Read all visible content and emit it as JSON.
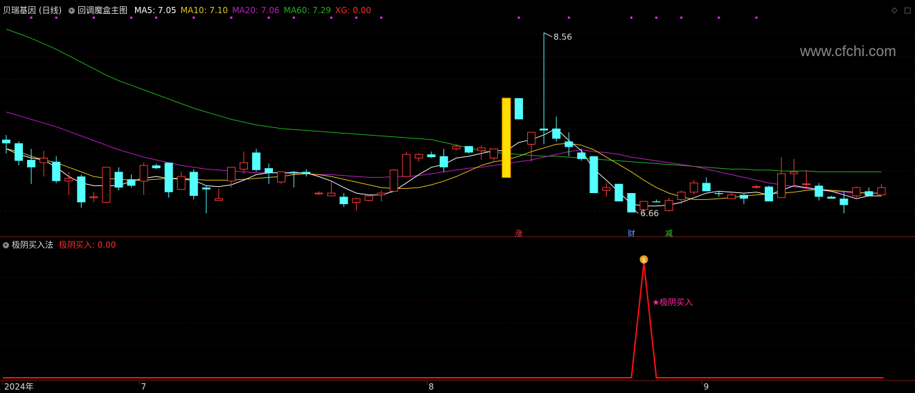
{
  "main_header": {
    "stock": "贝瑞基因 (日线)",
    "indicator_name": "回调魔盒主图",
    "items": [
      {
        "label": "MA5: 7.05",
        "color": "#ffffff"
      },
      {
        "label": "MA10: 7.10",
        "color": "#e6c619"
      },
      {
        "label": "MA20: 7.06",
        "color": "#c01ec8"
      },
      {
        "label": "MA60: 7.29",
        "color": "#1eb41e"
      },
      {
        "label": "XG: 0.00",
        "color": "#ff2a2a"
      }
    ]
  },
  "sub_header": {
    "indicator_name": "极阴买入法",
    "value_label": "极阴买入: 0.00"
  },
  "watermark": "www.cfchi.com",
  "controls": {
    "diamond": "◇",
    "box": "□"
  },
  "colors": {
    "up": "#ff3a3a",
    "down": "#54ffff",
    "ma5": "#ffffff",
    "ma10": "#e6c619",
    "ma20": "#c01ec8",
    "ma60": "#1eb41e",
    "signal": "#ff1010",
    "marker": "#ff2aff",
    "grid": "#3a0a0a",
    "axis": "#7a1a1a"
  },
  "chart_data": {
    "type": "candlestick",
    "x_labels": [
      "2024年",
      "7",
      "8",
      "9"
    ],
    "x_label_index": [
      0,
      11,
      34,
      56
    ],
    "ylim": [
      6.4,
      8.75
    ],
    "candles": [
      [
        7.4,
        7.45,
        7.25,
        7.36
      ],
      [
        7.36,
        7.38,
        7.12,
        7.17
      ],
      [
        7.18,
        7.3,
        6.92,
        7.1
      ],
      [
        7.15,
        7.28,
        7.0,
        7.2
      ],
      [
        7.16,
        7.22,
        6.93,
        6.95
      ],
      [
        6.95,
        7.05,
        6.8,
        6.98
      ],
      [
        7.0,
        7.02,
        6.66,
        6.72
      ],
      [
        6.77,
        6.83,
        6.72,
        6.78
      ],
      [
        6.72,
        7.1,
        6.72,
        7.1
      ],
      [
        7.05,
        7.1,
        6.85,
        6.88
      ],
      [
        6.97,
        7.02,
        6.88,
        6.9
      ],
      [
        6.95,
        7.15,
        6.8,
        7.12
      ],
      [
        7.12,
        7.14,
        7.08,
        7.09
      ],
      [
        7.15,
        7.15,
        6.77,
        6.83
      ],
      [
        6.86,
        7.05,
        6.86,
        7.0
      ],
      [
        7.05,
        7.08,
        6.75,
        6.79
      ],
      [
        6.88,
        6.9,
        6.6,
        6.86
      ],
      [
        6.74,
        6.87,
        6.74,
        6.76
      ],
      [
        6.95,
        7.1,
        6.88,
        7.1
      ],
      [
        7.08,
        7.27,
        7.03,
        7.15
      ],
      [
        7.26,
        7.3,
        7.05,
        7.07
      ],
      [
        7.09,
        7.14,
        6.92,
        7.04
      ],
      [
        6.94,
        7.05,
        6.92,
        7.05
      ],
      [
        7.05,
        7.06,
        6.88,
        7.04
      ],
      [
        7.05,
        7.08,
        7.0,
        7.03
      ],
      [
        6.82,
        6.84,
        6.8,
        6.82
      ],
      [
        6.79,
        6.95,
        6.79,
        6.82
      ],
      [
        6.78,
        6.82,
        6.67,
        6.7
      ],
      [
        6.72,
        6.77,
        6.63,
        6.76
      ],
      [
        6.74,
        6.8,
        6.73,
        6.79
      ],
      [
        6.8,
        6.85,
        6.73,
        6.82
      ],
      [
        6.84,
        7.08,
        6.84,
        7.07
      ],
      [
        7.0,
        7.27,
        7.0,
        7.24
      ],
      [
        7.2,
        7.25,
        7.16,
        7.24
      ],
      [
        7.24,
        7.27,
        7.2,
        7.21
      ],
      [
        7.22,
        7.3,
        7.05,
        7.1
      ],
      [
        7.3,
        7.35,
        7.28,
        7.33
      ],
      [
        7.33,
        7.3,
        7.25,
        7.26
      ],
      [
        7.28,
        7.34,
        7.18,
        7.31
      ],
      [
        7.2,
        7.3,
        7.17,
        7.3
      ],
      [
        7.61,
        7.61,
        7.18,
        7.18
      ],
      [
        7.85,
        7.85,
        7.62,
        7.62
      ],
      [
        7.35,
        7.48,
        7.16,
        7.48
      ],
      [
        7.52,
        8.56,
        7.35,
        7.5
      ],
      [
        7.52,
        7.65,
        7.38,
        7.41
      ],
      [
        7.38,
        7.48,
        7.22,
        7.32
      ],
      [
        7.26,
        7.3,
        7.17,
        7.19
      ],
      [
        7.22,
        7.22,
        6.82,
        6.82
      ],
      [
        6.85,
        6.93,
        6.78,
        6.88
      ],
      [
        6.92,
        6.92,
        6.73,
        6.73
      ],
      [
        6.82,
        6.82,
        6.66,
        6.61
      ],
      [
        6.64,
        6.73,
        6.58,
        6.73
      ],
      [
        6.73,
        6.75,
        6.72,
        6.72
      ],
      [
        6.63,
        6.77,
        6.62,
        6.74
      ],
      [
        6.75,
        6.85,
        6.7,
        6.83
      ],
      [
        6.83,
        6.96,
        6.8,
        6.93
      ],
      [
        6.93,
        6.99,
        6.89,
        6.84
      ],
      [
        6.82,
        6.84,
        6.78,
        6.81
      ],
      [
        6.76,
        6.82,
        6.76,
        6.8
      ],
      [
        6.8,
        6.81,
        6.7,
        6.76
      ],
      [
        6.89,
        6.91,
        6.87,
        6.89
      ],
      [
        6.89,
        6.9,
        6.73,
        6.73
      ],
      [
        6.77,
        7.21,
        6.77,
        7.03
      ],
      [
        7.03,
        7.19,
        6.89,
        7.05
      ],
      [
        6.92,
        7.07,
        6.88,
        6.92
      ],
      [
        6.9,
        6.93,
        6.74,
        6.78
      ],
      [
        6.78,
        6.79,
        6.76,
        6.76
      ],
      [
        6.76,
        6.83,
        6.6,
        6.69
      ],
      [
        6.79,
        6.89,
        6.77,
        6.88
      ],
      [
        6.84,
        6.88,
        6.79,
        6.79
      ],
      [
        6.8,
        6.92,
        6.8,
        6.88
      ]
    ],
    "signal_bar_index": 40,
    "ma5": [
      7.3,
      7.24,
      7.2,
      7.18,
      7.1,
      7.0,
      6.93,
      6.9,
      6.9,
      6.9,
      6.95,
      6.98,
      7.0,
      6.98,
      6.97,
      6.96,
      6.9,
      6.89,
      6.91,
      6.96,
      7.02,
      7.04,
      7.04,
      7.04,
      7.04,
      7.0,
      6.95,
      6.88,
      6.82,
      6.8,
      6.8,
      6.84,
      6.93,
      7.02,
      7.1,
      7.13,
      7.2,
      7.22,
      7.25,
      7.28,
      7.28,
      7.37,
      7.4,
      7.45,
      7.52,
      7.39,
      7.28,
      7.08,
      6.96,
      6.83,
      6.7,
      6.68,
      6.68,
      6.69,
      6.72,
      6.77,
      6.82,
      6.84,
      6.83,
      6.82,
      6.83,
      6.8,
      6.85,
      6.9,
      6.88,
      6.86,
      6.84,
      6.8,
      6.76,
      6.79,
      6.79
    ],
    "ma10": [
      7.3,
      7.27,
      7.22,
      7.18,
      7.15,
      7.1,
      7.05,
      7.0,
      6.98,
      6.97,
      6.96,
      6.96,
      6.97,
      6.98,
      6.98,
      6.97,
      6.96,
      6.96,
      6.96,
      6.97,
      6.98,
      6.99,
      7.0,
      7.02,
      7.03,
      7.02,
      7.0,
      6.97,
      6.94,
      6.91,
      6.88,
      6.87,
      6.87,
      6.88,
      6.91,
      6.95,
      7.0,
      7.06,
      7.12,
      7.16,
      7.18,
      7.22,
      7.27,
      7.31,
      7.35,
      7.36,
      7.34,
      7.29,
      7.21,
      7.13,
      7.05,
      6.96,
      6.88,
      6.82,
      6.78,
      6.75,
      6.75,
      6.76,
      6.77,
      6.79,
      6.8,
      6.81,
      6.82,
      6.83,
      6.85,
      6.86,
      6.85,
      6.84,
      6.83,
      6.82,
      6.82
    ],
    "ma20": [
      7.7,
      7.66,
      7.62,
      7.58,
      7.54,
      7.49,
      7.44,
      7.39,
      7.34,
      7.29,
      7.25,
      7.21,
      7.18,
      7.15,
      7.12,
      7.1,
      7.08,
      7.07,
      7.06,
      7.05,
      7.04,
      7.04,
      7.04,
      7.03,
      7.03,
      7.02,
      7.02,
      7.01,
      7.0,
      6.99,
      6.99,
      7.0,
      7.0,
      7.01,
      7.03,
      7.05,
      7.07,
      7.09,
      7.1,
      7.12,
      7.14,
      7.16,
      7.18,
      7.21,
      7.24,
      7.27,
      7.29,
      7.27,
      7.26,
      7.24,
      7.21,
      7.19,
      7.17,
      7.15,
      7.13,
      7.11,
      7.08,
      7.05,
      7.02,
      6.99,
      6.96,
      6.93,
      6.91,
      6.89,
      6.87,
      6.85,
      6.84,
      6.83,
      6.82,
      6.82,
      6.82
    ],
    "ma60": [
      8.6,
      8.55,
      8.5,
      8.44,
      8.38,
      8.31,
      8.24,
      8.17,
      8.1,
      8.04,
      7.99,
      7.94,
      7.89,
      7.84,
      7.79,
      7.74,
      7.7,
      7.66,
      7.62,
      7.59,
      7.56,
      7.54,
      7.52,
      7.51,
      7.5,
      7.49,
      7.48,
      7.47,
      7.46,
      7.45,
      7.44,
      7.43,
      7.42,
      7.41,
      7.4,
      7.37,
      7.34,
      7.31,
      7.28,
      7.26,
      7.25,
      7.24,
      7.23,
      7.22,
      7.22,
      7.21,
      7.2,
      7.19,
      7.18,
      7.17,
      7.16,
      7.15,
      7.14,
      7.13,
      7.12,
      7.11,
      7.1,
      7.09,
      7.08,
      7.08,
      7.07,
      7.07,
      7.06,
      7.06,
      7.06,
      7.05,
      7.05,
      7.05,
      7.05,
      7.05,
      7.05
    ],
    "high_annotation": {
      "index": 43,
      "label": "8.56"
    },
    "low_annotation": {
      "index": 50,
      "label": "6.66"
    },
    "top_markers": [
      2,
      4,
      7,
      10,
      12,
      15,
      18,
      21,
      23,
      26,
      28,
      30,
      41,
      45,
      50,
      52,
      54,
      57,
      60
    ],
    "event_markers": [
      {
        "index": 41,
        "label": "涨",
        "color": "#ff3a3a"
      },
      {
        "index": 50,
        "label": "财",
        "color": "#5aa0ff"
      },
      {
        "index": 53,
        "label": "减",
        "color": "#22dd22"
      }
    ],
    "sub_chart": {
      "name": "极阴买入",
      "ylim": [
        0,
        1
      ],
      "values_nonzero_index": 51,
      "annotation": "★极阴买入",
      "icon_label": "$"
    }
  }
}
